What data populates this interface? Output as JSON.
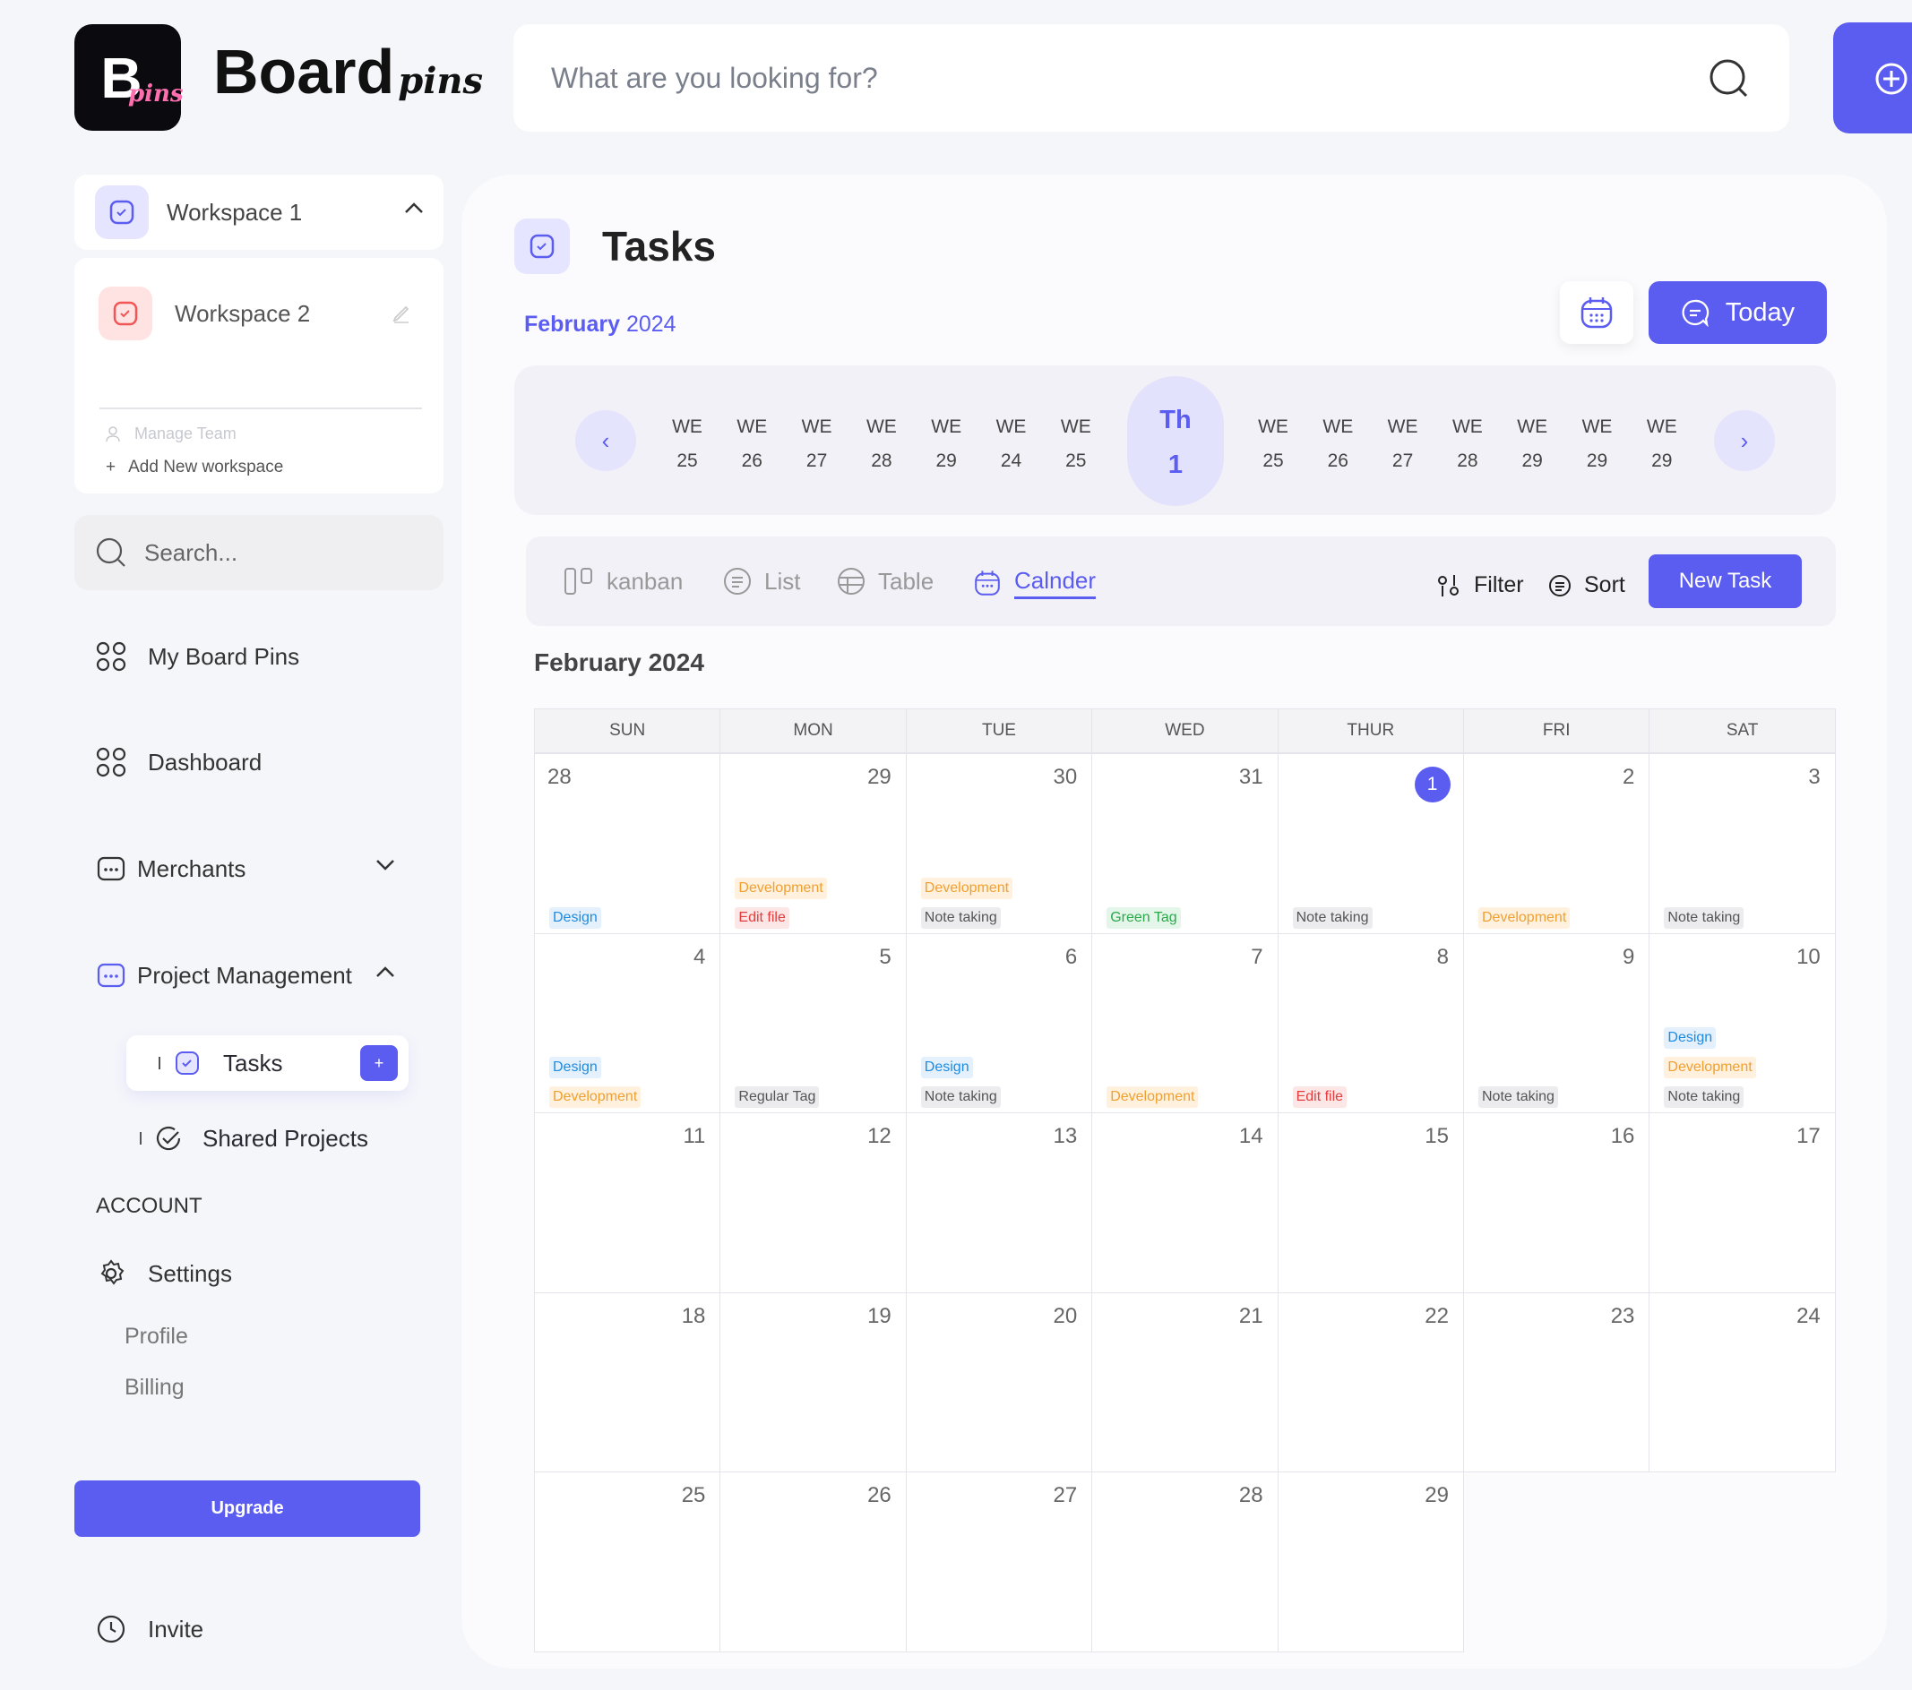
{
  "header": {
    "logo_letter": "B",
    "logo_pins": "pins",
    "brand": "Board",
    "brand_pins": "pins",
    "search_placeholder": "What are you looking for?",
    "add_icon": "plus-circle-icon"
  },
  "sidebar": {
    "workspace1": "Workspace 1",
    "workspace2": "Workspace 2",
    "manage_team": "Manage Team",
    "add_workspace": "Add New workspace",
    "search_placeholder": "Search...",
    "nav": {
      "my_board_pins": "My Board Pins",
      "dashboard": "Dashboard",
      "merchants": "Merchants",
      "project_management": "Project Management",
      "tasks": "Tasks",
      "shared_projects": "Shared Projects",
      "account": "ACCOUNT",
      "settings": "Settings",
      "profile": "Profile",
      "billing": "Billing",
      "upgrade": "Upgrade",
      "invite": "Invite"
    }
  },
  "main": {
    "title": "Tasks",
    "month_bold": "February",
    "month_year": "2024",
    "today_button": "Today",
    "date_strip": {
      "before": [
        [
          "WE",
          "25"
        ],
        [
          "WE",
          "26"
        ],
        [
          "WE",
          "27"
        ],
        [
          "WE",
          "28"
        ],
        [
          "WE",
          "29"
        ],
        [
          "WE",
          "24"
        ],
        [
          "WE",
          "25"
        ]
      ],
      "selected": [
        "Th",
        "1"
      ],
      "after": [
        [
          "WE",
          "25"
        ],
        [
          "WE",
          "26"
        ],
        [
          "WE",
          "27"
        ],
        [
          "WE",
          "28"
        ],
        [
          "WE",
          "29"
        ],
        [
          "WE",
          "29"
        ],
        [
          "WE",
          "29"
        ]
      ]
    },
    "views": {
      "kanban": "kanban",
      "list": "List",
      "table": "Table",
      "calendar": "Calnder",
      "active": "calendar"
    },
    "filter": "Filter",
    "sort": "Sort",
    "new_task": "New Task",
    "calendar_title": "February 2024",
    "weekdays": [
      "SUN",
      "MON",
      "TUE",
      "WED",
      "THUR",
      "FRI",
      "SAT"
    ],
    "weeks": [
      [
        {
          "day": "28",
          "tags": [
            [
              "Design",
              "blue"
            ]
          ]
        },
        {
          "day": "29",
          "tags": [
            [
              "Development",
              "orange"
            ],
            [
              "Edit file",
              "red"
            ]
          ]
        },
        {
          "day": "30",
          "tags": [
            [
              "Development",
              "orange"
            ],
            [
              "Note taking",
              "gray"
            ]
          ]
        },
        {
          "day": "31",
          "tags": [
            [
              "Green Tag",
              "green"
            ]
          ]
        },
        {
          "day": "1",
          "today": true,
          "tags": [
            [
              "Note taking",
              "gray"
            ]
          ]
        },
        {
          "day": "2",
          "tags": [
            [
              "Development",
              "orange"
            ]
          ]
        },
        {
          "day": "3",
          "tags": [
            [
              "Note taking",
              "gray"
            ]
          ]
        }
      ],
      [
        {
          "day": "4",
          "tags": [
            [
              "Design",
              "blue"
            ],
            [
              "Development",
              "orange"
            ]
          ]
        },
        {
          "day": "5",
          "tags": [
            [
              "Regular Tag",
              "gray"
            ]
          ]
        },
        {
          "day": "6",
          "tags": [
            [
              "Design",
              "blue"
            ],
            [
              "Note taking",
              "gray"
            ]
          ]
        },
        {
          "day": "7",
          "tags": [
            [
              "Development",
              "orange"
            ]
          ]
        },
        {
          "day": "8",
          "tags": [
            [
              "Edit file",
              "red"
            ]
          ]
        },
        {
          "day": "9",
          "tags": [
            [
              "Note taking",
              "gray"
            ]
          ]
        },
        {
          "day": "10",
          "tags": [
            [
              "Design",
              "blue"
            ],
            [
              "Development",
              "orange"
            ],
            [
              "Note taking",
              "gray"
            ]
          ]
        }
      ],
      [
        {
          "day": "11",
          "tags": []
        },
        {
          "day": "12",
          "tags": []
        },
        {
          "day": "13",
          "tags": []
        },
        {
          "day": "14",
          "tags": []
        },
        {
          "day": "15",
          "tags": []
        },
        {
          "day": "16",
          "tags": []
        },
        {
          "day": "17",
          "tags": []
        }
      ],
      [
        {
          "day": "18",
          "tags": []
        },
        {
          "day": "19",
          "tags": []
        },
        {
          "day": "20",
          "tags": []
        },
        {
          "day": "21",
          "tags": []
        },
        {
          "day": "22",
          "tags": []
        },
        {
          "day": "23",
          "tags": []
        },
        {
          "day": "24",
          "tags": []
        }
      ],
      [
        {
          "day": "25",
          "tags": []
        },
        {
          "day": "26",
          "tags": []
        },
        {
          "day": "27",
          "tags": []
        },
        {
          "day": "28",
          "tags": []
        },
        {
          "day": "29",
          "tags": []
        }
      ]
    ]
  },
  "colors": {
    "accent": "#5B5CF0",
    "tag_blue": "#1E8BE0",
    "tag_orange": "#F0A030",
    "tag_red": "#E33D3D",
    "tag_green": "#2AA84A"
  }
}
